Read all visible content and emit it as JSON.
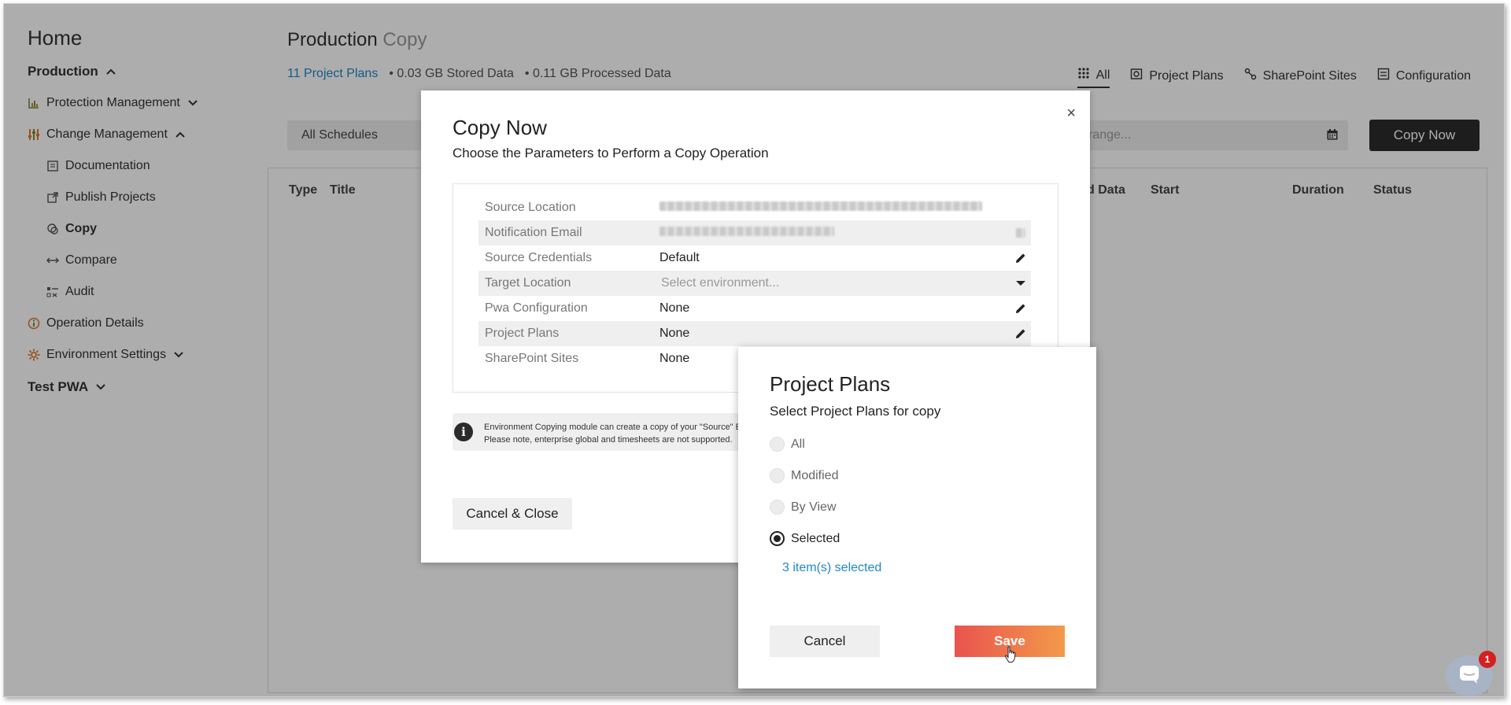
{
  "sidebar": {
    "home": "Home",
    "production": "Production",
    "items": [
      {
        "label": "Protection Management"
      },
      {
        "label": "Change Management"
      },
      {
        "label": "Documentation"
      },
      {
        "label": "Publish Projects"
      },
      {
        "label": "Copy"
      },
      {
        "label": "Compare"
      },
      {
        "label": "Audit"
      },
      {
        "label": "Operation Details"
      },
      {
        "label": "Environment Settings"
      }
    ],
    "test_pwa": "Test PWA"
  },
  "header": {
    "title": "Production",
    "title_muted": "Copy",
    "project_plans_link": "11 Project Plans",
    "stored": "• 0.03 GB Stored Data",
    "processed": "• 0.11 GB Processed Data",
    "tabs": [
      {
        "label": "All"
      },
      {
        "label": "Project Plans"
      },
      {
        "label": "SharePoint Sites"
      },
      {
        "label": "Configuration"
      }
    ]
  },
  "toolbar": {
    "schedule_filter": "All Schedules",
    "date_placeholder": "range...",
    "copy_now": "Copy Now"
  },
  "table": {
    "columns": [
      "Type",
      "Title",
      "d Data",
      "Start",
      "Duration",
      "Status"
    ]
  },
  "copy_modal": {
    "close": "×",
    "title": "Copy Now",
    "subtitle": "Choose the Parameters to Perform a Copy Operation",
    "rows": [
      {
        "label": "Source Location",
        "value": ""
      },
      {
        "label": "Notification Email",
        "value": ""
      },
      {
        "label": "Source Credentials",
        "value": "Default"
      },
      {
        "label": "Target Location",
        "value": "Select environment..."
      },
      {
        "label": "Pwa Configuration",
        "value": "None"
      },
      {
        "label": "Project Plans",
        "value": "None"
      },
      {
        "label": "SharePoint Sites",
        "value": "None"
      }
    ],
    "info_line1": "Environment Copying module can create a copy of your \"Source\" En",
    "info_line2": "Please note, enterprise global and timesheets are not supported.",
    "cancel_close": "Cancel & Close"
  },
  "project_plans_dialog": {
    "title": "Project Plans",
    "subtitle": "Select Project Plans for copy",
    "options": [
      {
        "label": "All",
        "checked": false
      },
      {
        "label": "Modified",
        "checked": false
      },
      {
        "label": "By View",
        "checked": false
      },
      {
        "label": "Selected",
        "checked": true
      }
    ],
    "selected_link": "3 item(s) selected",
    "cancel": "Cancel",
    "save": "Save"
  },
  "chat": {
    "badge": "1"
  },
  "colors": {
    "link": "#1e88c7",
    "save_gradient_start": "#e9534e",
    "save_gradient_end": "#f39a4a",
    "dark_button": "#2b2b2b",
    "badge": "#d32020"
  }
}
